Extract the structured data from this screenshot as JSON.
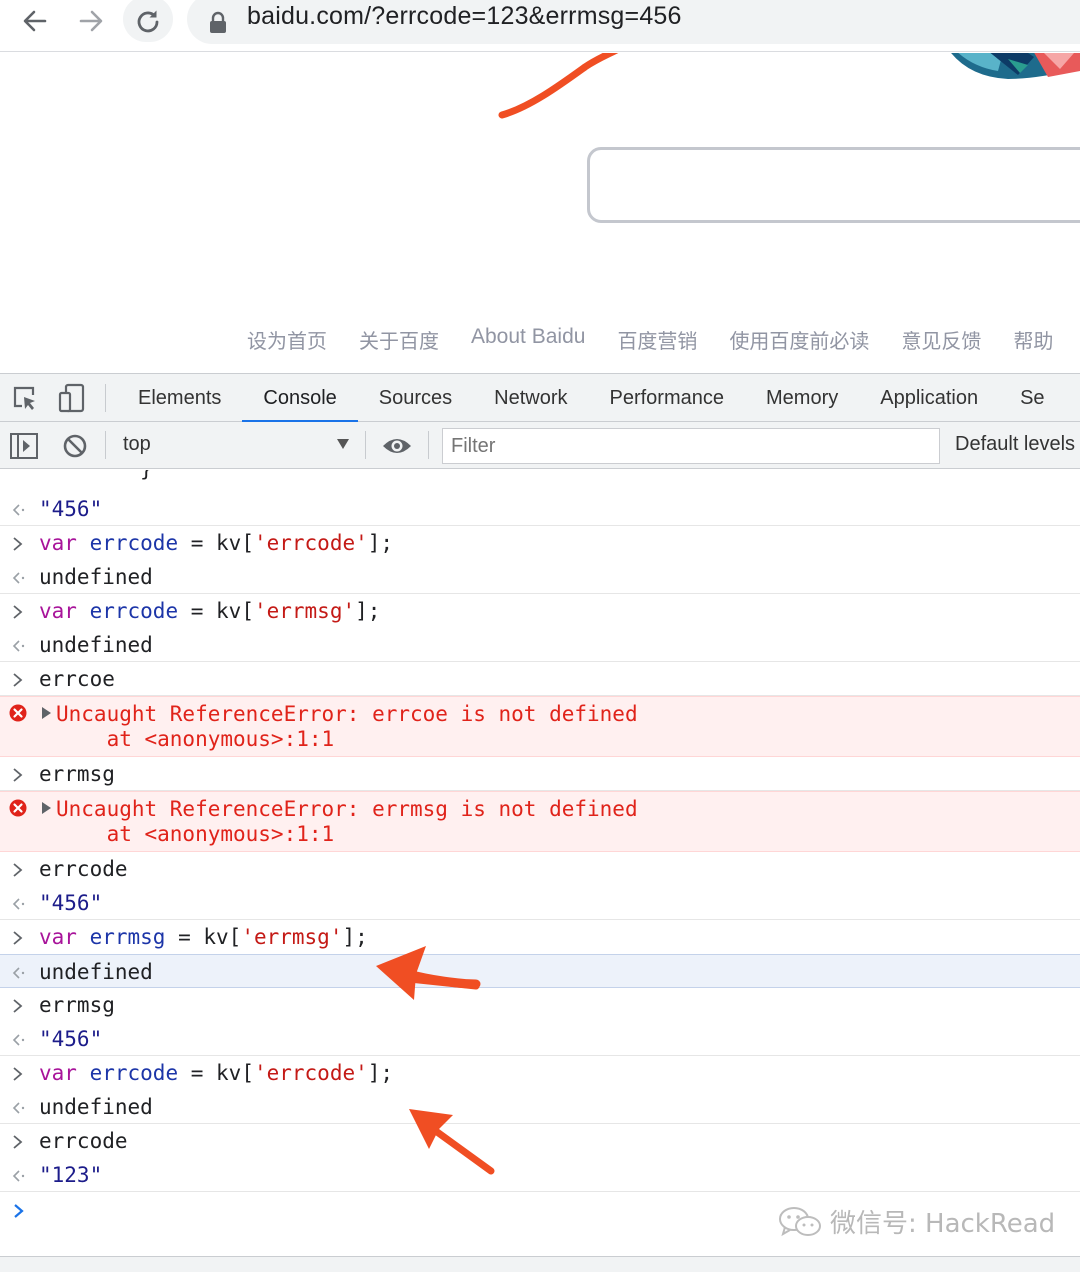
{
  "browser": {
    "url": "baidu.com/?errcode=123&errmsg=456"
  },
  "page": {
    "footer_links": [
      "设为首页",
      "关于百度",
      "About Baidu",
      "百度营销",
      "使用百度前必读",
      "意见反馈",
      "帮助"
    ]
  },
  "devtools": {
    "tabs": [
      "Elements",
      "Console",
      "Sources",
      "Network",
      "Performance",
      "Memory",
      "Application",
      "Se"
    ],
    "active_tab": "Console",
    "context": "top",
    "filter_placeholder": "Filter",
    "levels": "Default levels"
  },
  "console": {
    "brace_fragment": "}",
    "entries": [
      {
        "kind": "result",
        "text": "\"456\""
      },
      {
        "kind": "input",
        "parts": [
          [
            "k",
            "var"
          ],
          [
            "p",
            " "
          ],
          [
            "v",
            "errcode"
          ],
          [
            "p",
            " = kv["
          ],
          [
            "s",
            "'errcode'"
          ],
          [
            "p",
            "];"
          ]
        ]
      },
      {
        "kind": "result",
        "text": "undefined"
      },
      {
        "kind": "input",
        "parts": [
          [
            "k",
            "var"
          ],
          [
            "p",
            " "
          ],
          [
            "v",
            "errcode"
          ],
          [
            "p",
            " = kv["
          ],
          [
            "s",
            "'errmsg'"
          ],
          [
            "p",
            "];"
          ]
        ]
      },
      {
        "kind": "result",
        "text": "undefined"
      },
      {
        "kind": "input",
        "parts": [
          [
            "p",
            "errcoe"
          ]
        ]
      },
      {
        "kind": "error",
        "line1": "Uncaught ReferenceError: errcoe is not defined",
        "line2": "    at <anonymous>:1:1"
      },
      {
        "kind": "input",
        "parts": [
          [
            "p",
            "errmsg"
          ]
        ]
      },
      {
        "kind": "error",
        "line1": "Uncaught ReferenceError: errmsg is not defined",
        "line2": "    at <anonymous>:1:1"
      },
      {
        "kind": "input",
        "parts": [
          [
            "p",
            "errcode"
          ]
        ]
      },
      {
        "kind": "result",
        "text": "\"456\""
      },
      {
        "kind": "input",
        "parts": [
          [
            "k",
            "var"
          ],
          [
            "p",
            " "
          ],
          [
            "v",
            "errmsg"
          ],
          [
            "p",
            " = kv["
          ],
          [
            "s",
            "'errmsg'"
          ],
          [
            "p",
            "];"
          ]
        ]
      },
      {
        "kind": "result",
        "text": "undefined",
        "highlighted": true
      },
      {
        "kind": "input",
        "parts": [
          [
            "p",
            "errmsg"
          ]
        ]
      },
      {
        "kind": "result",
        "text": "\"456\""
      },
      {
        "kind": "input",
        "parts": [
          [
            "k",
            "var"
          ],
          [
            "p",
            " "
          ],
          [
            "v",
            "errcode"
          ],
          [
            "p",
            " = kv["
          ],
          [
            "s",
            "'errcode'"
          ],
          [
            "p",
            "];"
          ]
        ]
      },
      {
        "kind": "result",
        "text": "undefined"
      },
      {
        "kind": "input",
        "parts": [
          [
            "p",
            "errcode"
          ]
        ]
      },
      {
        "kind": "result",
        "text": "\"123\""
      }
    ]
  },
  "watermark": {
    "text": "微信号: HackRead"
  },
  "colors": {
    "annotation": "#f04e23",
    "accent": "#1a73e8",
    "error_text": "#e0231a",
    "error_bg": "#fff0f0"
  },
  "icons": [
    "back-arrow-icon",
    "forward-arrow-icon",
    "reload-icon",
    "lock-icon",
    "inspect-element-icon",
    "device-toolbar-icon",
    "sidebar-toggle-icon",
    "clear-console-icon",
    "eye-icon",
    "error-icon",
    "wechat-icon"
  ]
}
